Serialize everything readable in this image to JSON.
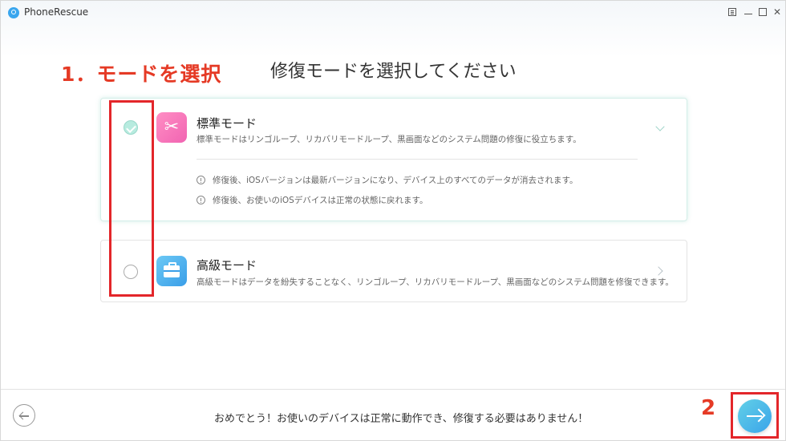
{
  "window": {
    "title": "PhoneRescue",
    "controls": [
      "menu",
      "minimize",
      "maximize",
      "close"
    ]
  },
  "annotations": {
    "step1": "1．モードを選択",
    "step2": "2",
    "highlight_color": "#e3262a"
  },
  "main": {
    "title": "修復モードを選択してください",
    "modes": [
      {
        "name": "標準モード",
        "description": "標準モードはリンゴループ、リカバリモードループ、黒画面などのシステム問題の修復に役立ちます。",
        "selected": true,
        "expanded": true,
        "icon": "tools-icon",
        "notes": [
          "修復後、iOSバージョンは最新バージョンになり、デバイス上のすべてのデータが消去されます。",
          "修復後、お使いのiOSデバイスは正常の状態に戻れます。"
        ]
      },
      {
        "name": "高級モード",
        "description": "高級モードはデータを紛失することなく、リンゴループ、リカバリモードループ、黒画面などのシステム問題を修復できます。",
        "selected": false,
        "expanded": false,
        "icon": "toolbox-icon"
      }
    ]
  },
  "footer": {
    "message": "おめでとう！お使いのデバイスは正常に動作でき、修復する必要はありません！",
    "back_icon": "arrow-left-icon",
    "next_icon": "arrow-right-icon"
  },
  "colors": {
    "accent": "#3aa4ea",
    "selected_radio": "#b7ebdf",
    "standard_icon": "#f164b2",
    "advanced_icon": "#3a9ee8"
  }
}
